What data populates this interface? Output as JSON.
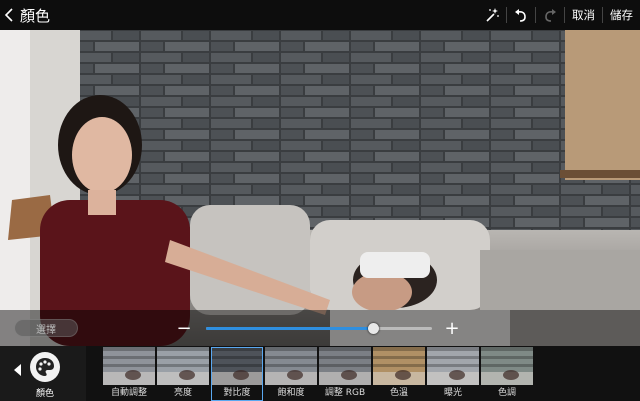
{
  "header": {
    "title": "顏色",
    "cancel_label": "取消",
    "save_label": "儲存"
  },
  "adjust": {
    "select_label": "選擇",
    "minus_label": "−",
    "plus_label": "+",
    "level": 0.74
  },
  "bottom": {
    "category_label": "顏色",
    "filters": [
      {
        "label": "自動調整",
        "tint": "#8f939a",
        "selected": false
      },
      {
        "label": "亮度",
        "tint": "#9aa0a7",
        "selected": false
      },
      {
        "label": "對比度",
        "tint": "#4e535a",
        "selected": true
      },
      {
        "label": "飽和度",
        "tint": "#858a91",
        "selected": false
      },
      {
        "label": "調整 RGB",
        "tint": "#7b7f85",
        "selected": false
      },
      {
        "label": "色溫",
        "tint": "#b09065",
        "selected": false
      },
      {
        "label": "曝光",
        "tint": "#a2a6ac",
        "selected": false
      },
      {
        "label": "色調",
        "tint": "#7f8a86",
        "selected": false
      }
    ]
  },
  "colors": {
    "accent": "#2f8fe0",
    "selection": "#5aa8f0"
  }
}
